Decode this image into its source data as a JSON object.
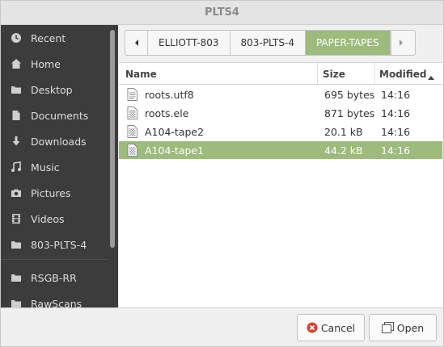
{
  "window": {
    "title": "PLTS4"
  },
  "sidebar": {
    "items": [
      {
        "label": "Recent",
        "icon": "clock-icon"
      },
      {
        "label": "Home",
        "icon": "home-icon"
      },
      {
        "label": "Desktop",
        "icon": "desktop-icon"
      },
      {
        "label": "Documents",
        "icon": "document-icon"
      },
      {
        "label": "Downloads",
        "icon": "download-icon"
      },
      {
        "label": "Music",
        "icon": "music-icon"
      },
      {
        "label": "Pictures",
        "icon": "camera-icon"
      },
      {
        "label": "Videos",
        "icon": "film-icon"
      },
      {
        "label": "803-PLTS-4",
        "icon": "folder-icon"
      },
      {
        "label": "RSGB-RR",
        "icon": "folder-icon"
      },
      {
        "label": "RawScans",
        "icon": "folder-icon"
      }
    ]
  },
  "pathbar": {
    "segments": [
      "ELLIOTT-803",
      "803-PLTS-4",
      "PAPER-TAPES"
    ],
    "active_index": 2
  },
  "filelist": {
    "columns": {
      "name": "Name",
      "size": "Size",
      "modified": "Modified"
    },
    "sort_column": "modified",
    "rows": [
      {
        "name": "roots.utf8",
        "size": "695 bytes",
        "modified": "14:16",
        "icon": "text-file-icon"
      },
      {
        "name": "roots.ele",
        "size": "871 bytes",
        "modified": "14:16",
        "icon": "binary-file-icon"
      },
      {
        "name": "A104-tape2",
        "size": "20.1 kB",
        "modified": "14:16",
        "icon": "binary-file-icon"
      },
      {
        "name": "A104-tape1",
        "size": "44.2 kB",
        "modified": "14:16",
        "icon": "binary-file-icon",
        "selected": true
      }
    ]
  },
  "footer": {
    "cancel_label": "Cancel",
    "open_label": "Open"
  },
  "colors": {
    "accent": "#9cbb7c",
    "sidebar_bg": "#3c3c3c",
    "cancel_icon": "#d0453a"
  }
}
